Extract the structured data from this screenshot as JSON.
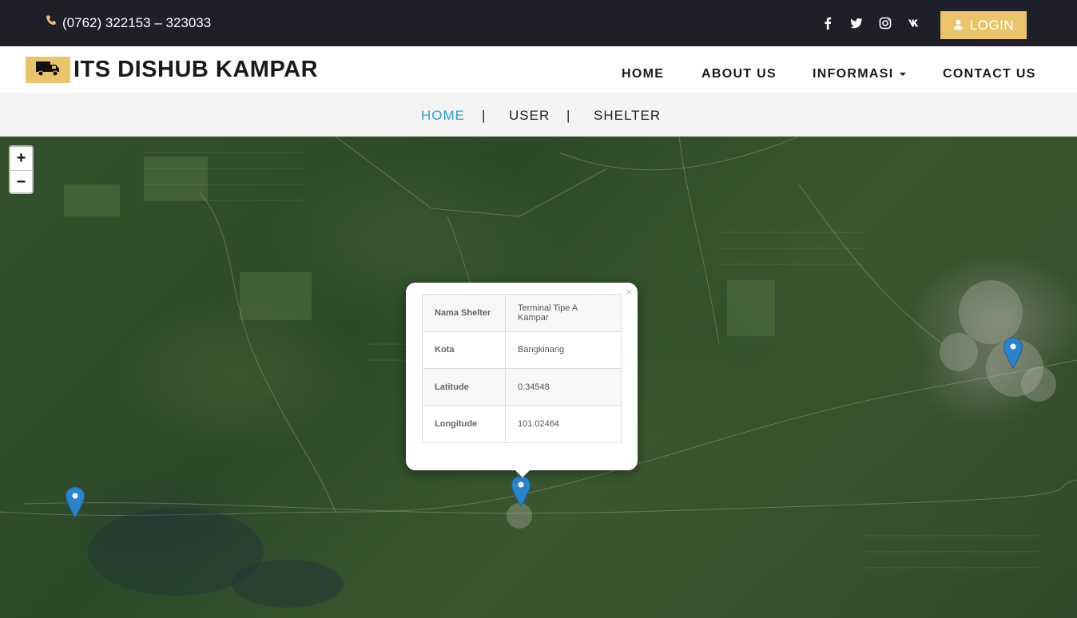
{
  "topbar": {
    "phone": "(0762) 322153 – 323033",
    "socials": [
      {
        "icon": "facebook-icon"
      },
      {
        "icon": "twitter-icon"
      },
      {
        "icon": "instagram-icon"
      },
      {
        "icon": "vk-icon"
      }
    ],
    "login_label": "LOGIN"
  },
  "header": {
    "brand": "ITS DISHUB KAMPAR",
    "nav": [
      {
        "label": "HOME"
      },
      {
        "label": "ABOUT US"
      },
      {
        "label": "INFORMASI"
      },
      {
        "label": "CONTACT US"
      }
    ]
  },
  "subnav": {
    "items": [
      {
        "label": "HOME",
        "active": true
      },
      {
        "label": "USER",
        "active": false
      },
      {
        "label": "SHELTER",
        "active": false
      }
    ],
    "separator": "|"
  },
  "map": {
    "zoom_in": "+",
    "zoom_out": "−",
    "popup": {
      "close": "×",
      "rows": [
        {
          "key": "Nama Shelter",
          "value": "Terminal Tipe A Kampar"
        },
        {
          "key": "Kota",
          "value": "Bangkinang"
        },
        {
          "key": "Latitude",
          "value": "0.34548"
        },
        {
          "key": "Longitude",
          "value": "101.02464"
        }
      ]
    }
  },
  "colors": {
    "accent": "#e9c46a",
    "topbar_bg": "#1f1f29",
    "link_active": "#29a0d8",
    "marker": "#2b84cb"
  }
}
